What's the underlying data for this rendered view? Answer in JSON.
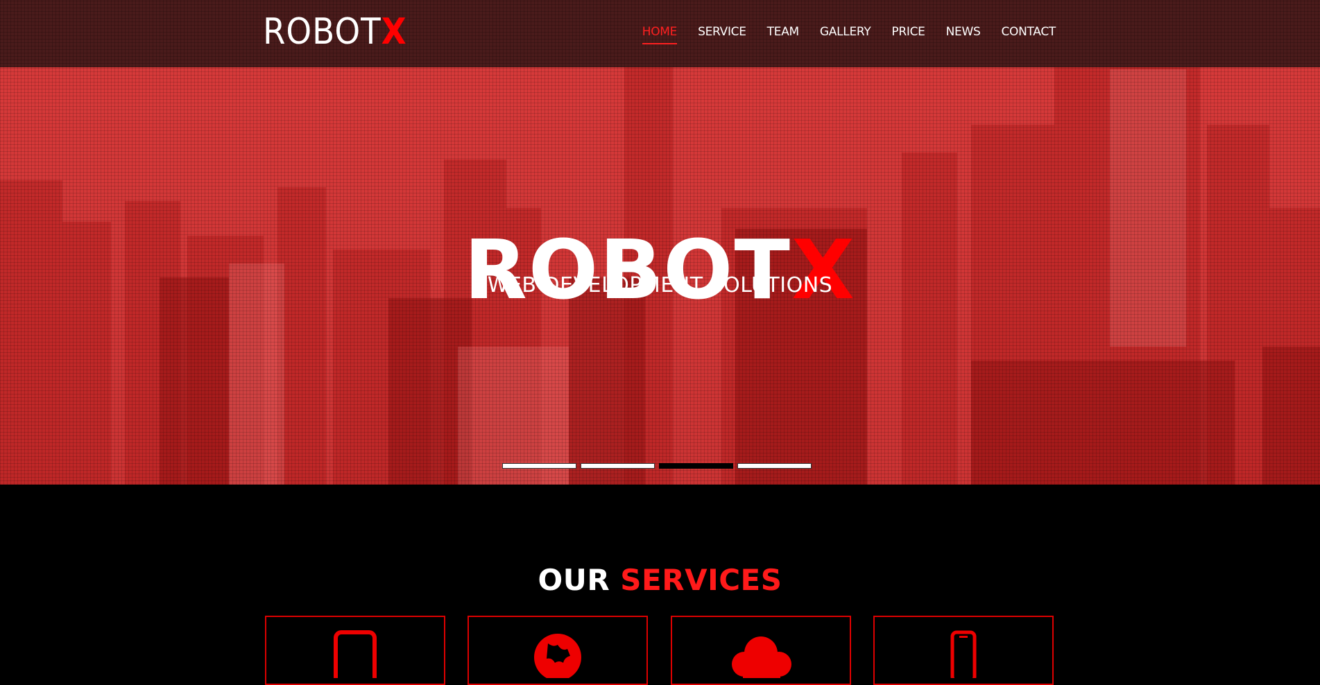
{
  "brand": {
    "name_main": "ROBOT",
    "name_accent": "X"
  },
  "nav": {
    "items": [
      {
        "label": "HOME",
        "active": true
      },
      {
        "label": "SERVICE",
        "active": false
      },
      {
        "label": "TEAM",
        "active": false
      },
      {
        "label": "GALLERY",
        "active": false
      },
      {
        "label": "PRICE",
        "active": false
      },
      {
        "label": "NEWS",
        "active": false
      },
      {
        "label": "CONTACT",
        "active": false
      }
    ]
  },
  "hero": {
    "title_main": "ROBOT",
    "title_accent": "X",
    "subtitle": "WEB DEVELOPMENT SOLUTIONS",
    "slides": 4,
    "active_slide": 3
  },
  "services": {
    "title_main": "OUR",
    "title_accent": "SERVICES",
    "cards": [
      {
        "icon": "tablet-icon"
      },
      {
        "icon": "globe-icon"
      },
      {
        "icon": "cloud-icon"
      },
      {
        "icon": "mobile-phone-icon"
      }
    ]
  },
  "colors": {
    "accent": "#ff0000",
    "hero_tint": "#d33a3a",
    "nav_bg": "#4a1b1b",
    "page_bg": "#000000"
  }
}
